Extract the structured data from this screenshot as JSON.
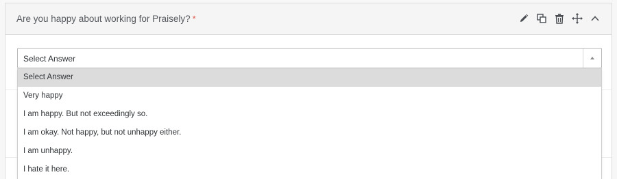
{
  "question": {
    "title": "Are you happy about working for Praisely?",
    "required_mark": "*"
  },
  "toolbar": {
    "icons": [
      "pencil-icon",
      "copy-icon",
      "trash-icon",
      "move-icon",
      "chevron-up-icon"
    ]
  },
  "select": {
    "current_value": "Select Answer",
    "options": [
      "Select Answer",
      "Very happy",
      "I am happy. But not exceedingly so.",
      "I am okay. Not happy, but not unhappy either.",
      "I am unhappy.",
      "I hate it here."
    ],
    "highlighted_option": "Select Answer"
  },
  "colors": {
    "required": "#e05a4f",
    "highlight": "#dcdcdc",
    "header_bg": "#f5f5f5"
  }
}
